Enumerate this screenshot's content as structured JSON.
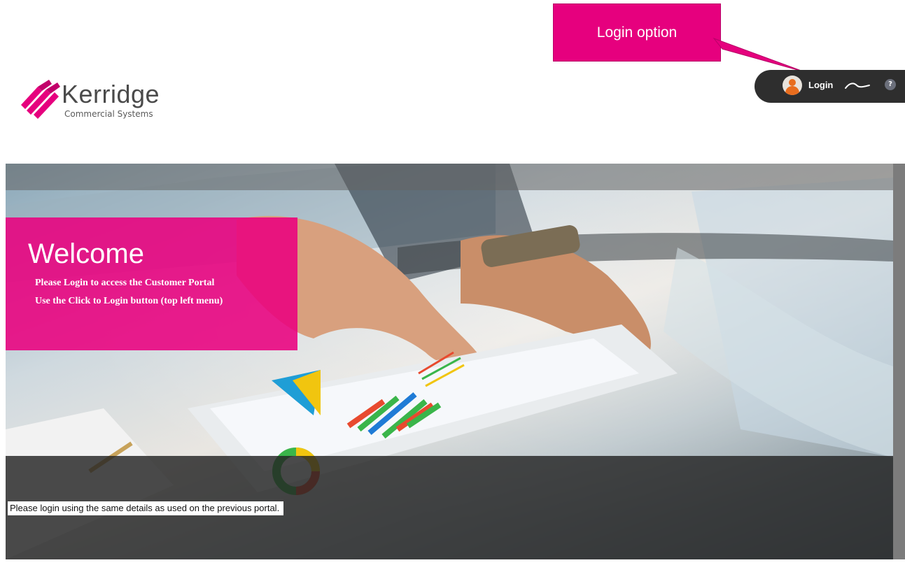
{
  "callout": {
    "text": "Login option"
  },
  "logo": {
    "word": "Kerridge",
    "sub": "Commercial Systems",
    "brand_color": "#e6007e"
  },
  "menu": {
    "login_label": "Login",
    "avatar_icon": "user-avatar-icon",
    "swoosh_icon": "swoosh-icon",
    "help_icon": "help-icon",
    "help_symbol": "?",
    "bar_color": "#2e2e2e"
  },
  "welcome": {
    "title": "Welcome",
    "line1": "Please Login to access the Customer Portal",
    "line2": "Use the Click to Login button (top left menu)",
    "color": "#e9007e"
  },
  "notice": {
    "text": "Please login using the same details as used on the previous portal."
  }
}
